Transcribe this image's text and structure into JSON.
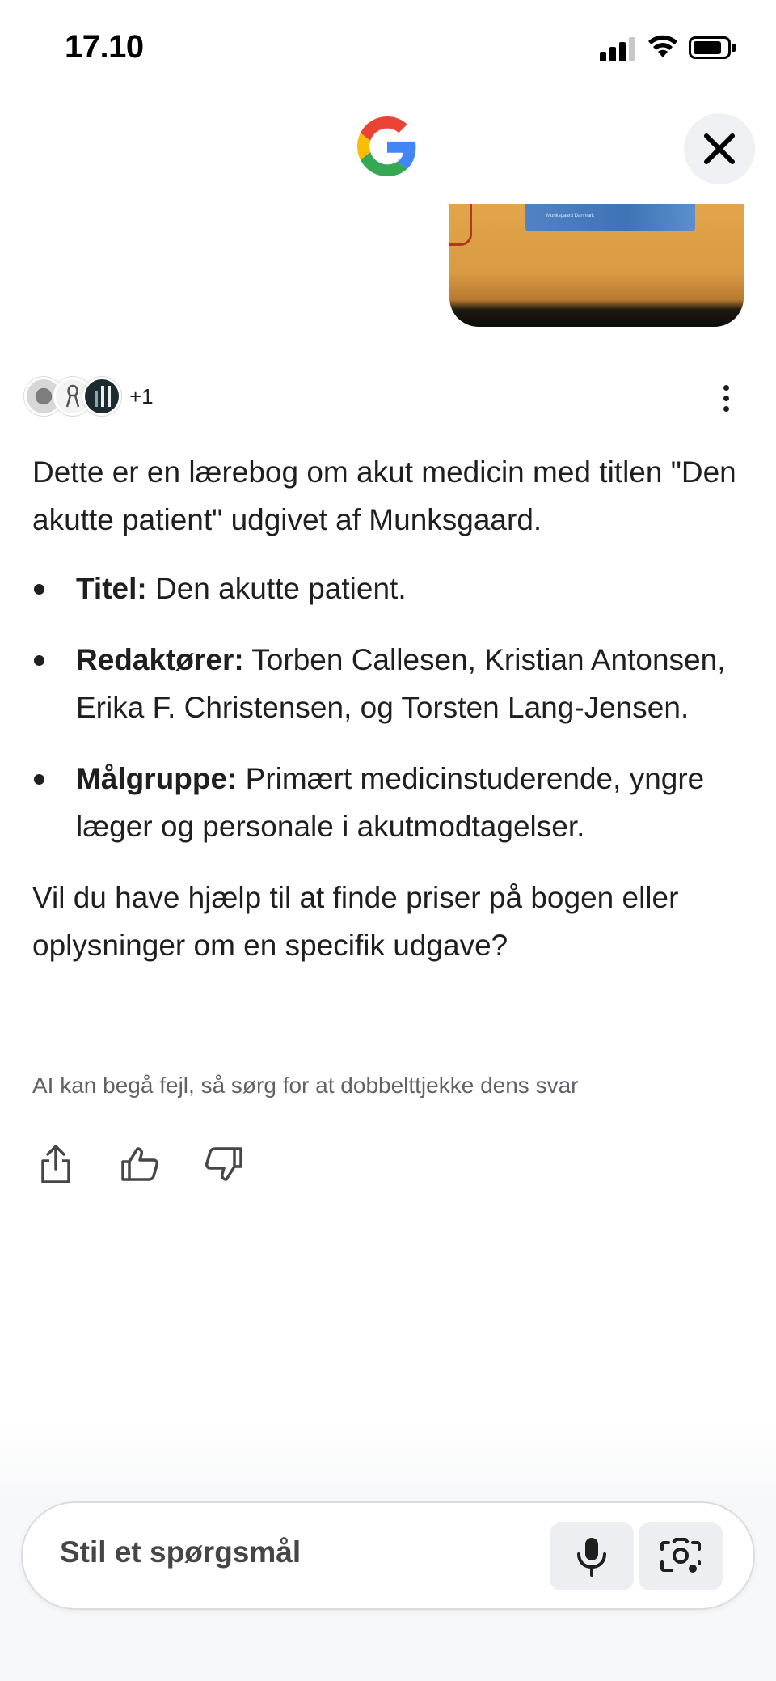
{
  "status_bar": {
    "time": "17.10",
    "icons": [
      "signal-icon",
      "wifi-icon",
      "battery-icon"
    ]
  },
  "header": {
    "logo": "google-g-logo",
    "close_icon": "close-icon"
  },
  "captured_image": {
    "book_label": "Munksgaard Danmark"
  },
  "sources": {
    "more_label": "+1",
    "icons": [
      "source-favicon-1",
      "source-favicon-2",
      "source-favicon-3"
    ]
  },
  "answer": {
    "intro": "Dette er en lærebog om akut medicin med titlen \"Den akutte patient\" udgivet af Munksgaard.",
    "items": [
      {
        "label": "Titel:",
        "text": " Den akutte patient."
      },
      {
        "label": "Redaktører:",
        "text": " Torben Callesen, Kristian Antonsen, Erika F. Christensen, og Torsten Lang-Jensen."
      },
      {
        "label": "Målgruppe:",
        "text": " Primært medicinstuderende, yngre læger og personale i akutmodtagelser."
      }
    ],
    "question": "Vil du have hjælp til at finde priser på bogen eller oplysninger om en specifik udgave?"
  },
  "disclaimer": "AI kan begå fejl, så sørg for at dobbelttjekke dens svar",
  "actions": [
    "share-icon",
    "thumbs-up-icon",
    "thumbs-down-icon"
  ],
  "input": {
    "placeholder": "Stil et spørgsmål",
    "mic_icon": "microphone-icon",
    "lens_icon": "google-lens-icon"
  },
  "colors": {
    "google_blue": "#4285F4",
    "google_red": "#EA4335",
    "google_yellow": "#FBBC05",
    "google_green": "#34A853",
    "text": "#1f1f1f",
    "muted": "#5f6368"
  }
}
